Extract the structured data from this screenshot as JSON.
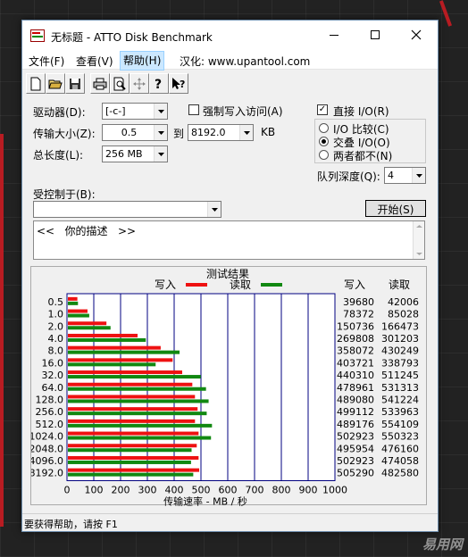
{
  "window": {
    "title": "无标题 - ATTO Disk Benchmark"
  },
  "menu": [
    "文件(F)",
    "查看(V)",
    "帮助(H)",
    "汉化: www.upantool.com"
  ],
  "toolbar_icons": [
    "new-icon",
    "open-icon",
    "save-icon",
    "print-icon",
    "print-preview-icon",
    "move-icon",
    "help-icon",
    "context-help-icon"
  ],
  "form": {
    "drive_label": "驱动器(D):",
    "drive_value": "[-c-]",
    "force_write_label": "强制写入访问(A)",
    "force_write_checked": false,
    "transfer_label": "传输大小(Z):",
    "transfer_from": "0.5",
    "to_label": "到",
    "transfer_to": "8192.0",
    "kb_label": "KB",
    "total_label": "总长度(L):",
    "total_value": "256 MB",
    "direct_io_label": "直接 I/O(R)",
    "direct_io_checked": true,
    "io_compare_label": "I/O 比较(C)",
    "overlap_label": "交叠 I/O(O)",
    "neither_label": "两者都不(N)",
    "queue_label": "队列深度(Q):",
    "queue_value": "4",
    "controlled_by_label": "受控制于(B):",
    "controlled_by_value": "",
    "start_button": "开始(S)",
    "description": "<<   你的描述   >>"
  },
  "status_text": "要获得帮助，请按 F1",
  "watermark": "易用网",
  "colors": {
    "write": "#ee1111",
    "read": "#118811",
    "grid": "#000080"
  },
  "chart_data": {
    "type": "bar",
    "title": "测试结果",
    "legend": [
      "写入",
      "读取"
    ],
    "xlabel": "传输速率 - MB / 秒",
    "xlim": [
      0,
      1000
    ],
    "xticks": [
      0,
      100,
      200,
      300,
      400,
      500,
      600,
      700,
      800,
      900,
      1000
    ],
    "col_headers": [
      "写入",
      "读取"
    ],
    "categories": [
      "0.5",
      "1.0",
      "2.0",
      "4.0",
      "8.0",
      "16.0",
      "32.0",
      "64.0",
      "128.0",
      "256.0",
      "512.0",
      "1024.0",
      "2048.0",
      "4096.0",
      "8192.0"
    ],
    "series": [
      {
        "name": "写入",
        "values": [
          39680,
          78372,
          150736,
          269808,
          358072,
          403721,
          440310,
          478961,
          489080,
          499112,
          489176,
          502923,
          495954,
          502923,
          505290
        ]
      },
      {
        "name": "读取",
        "values": [
          42006,
          85028,
          166473,
          301203,
          430249,
          338793,
          511245,
          531313,
          541224,
          533963,
          554109,
          550323,
          476160,
          474058,
          482580
        ]
      }
    ]
  }
}
